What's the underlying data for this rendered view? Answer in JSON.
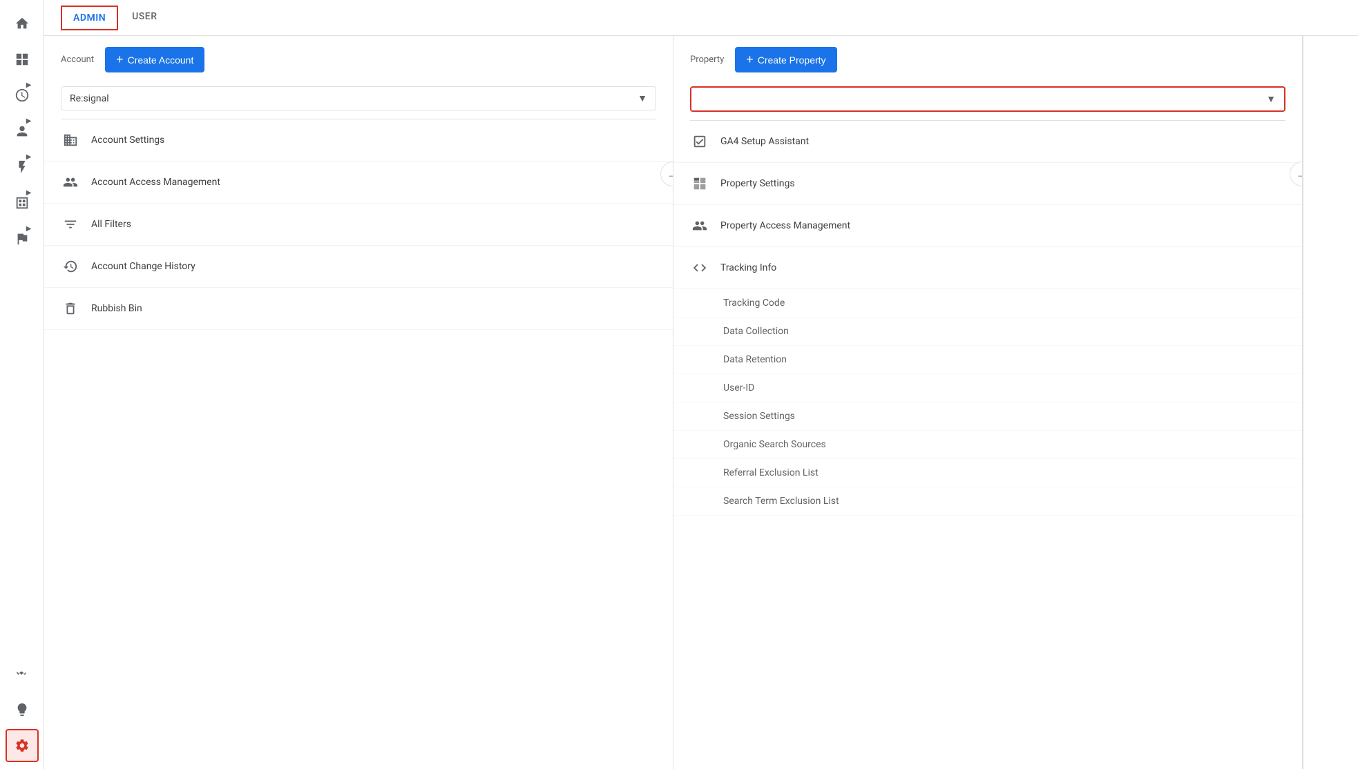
{
  "sidebar": {
    "icons": [
      {
        "name": "home-icon",
        "symbol": "⌂",
        "interactable": true
      },
      {
        "name": "dashboard-icon",
        "symbol": "⊞",
        "interactable": true
      },
      {
        "name": "clock-icon",
        "symbol": "◷",
        "interactable": true
      },
      {
        "name": "person-icon",
        "symbol": "👤",
        "interactable": true
      },
      {
        "name": "lightning-icon",
        "symbol": "⚡",
        "interactable": true
      },
      {
        "name": "table-icon",
        "symbol": "▤",
        "interactable": true
      },
      {
        "name": "flag-icon",
        "symbol": "⚑",
        "interactable": true
      }
    ],
    "bottom_icons": [
      {
        "name": "squiggle-icon",
        "symbol": "∿",
        "interactable": true
      },
      {
        "name": "lightbulb-icon",
        "symbol": "💡",
        "interactable": true
      },
      {
        "name": "gear-icon",
        "symbol": "⚙",
        "interactable": true,
        "active": true
      }
    ]
  },
  "top_nav": {
    "admin_tab": "ADMIN",
    "user_tab": "USER"
  },
  "account_column": {
    "label": "Account",
    "create_button": "Create Account",
    "dropdown_value": "Re:signal",
    "menu_items": [
      {
        "id": "account-settings",
        "icon": "building-icon",
        "label": "Account Settings"
      },
      {
        "id": "account-access",
        "icon": "people-icon",
        "label": "Account Access Management"
      },
      {
        "id": "all-filters",
        "icon": "filter-icon",
        "label": "All Filters"
      },
      {
        "id": "account-history",
        "icon": "history-icon",
        "label": "Account Change History"
      },
      {
        "id": "rubbish-bin",
        "icon": "trash-icon",
        "label": "Rubbish Bin"
      }
    ]
  },
  "property_column": {
    "label": "Property",
    "create_button": "Create Property",
    "dropdown_value": "",
    "dropdown_placeholder": "",
    "menu_items": [
      {
        "id": "ga4-setup",
        "icon": "checkbox-icon",
        "label": "GA4 Setup Assistant"
      },
      {
        "id": "property-settings",
        "icon": "layout-icon",
        "label": "Property Settings"
      },
      {
        "id": "property-access",
        "icon": "people-icon",
        "label": "Property Access Management"
      },
      {
        "id": "tracking-info",
        "icon": "code-icon",
        "label": "Tracking Info",
        "type": "group"
      }
    ],
    "sub_items": [
      {
        "id": "tracking-code",
        "label": "Tracking Code"
      },
      {
        "id": "data-collection",
        "label": "Data Collection"
      },
      {
        "id": "data-retention",
        "label": "Data Retention"
      },
      {
        "id": "user-id",
        "label": "User-ID"
      },
      {
        "id": "session-settings",
        "label": "Session Settings"
      },
      {
        "id": "organic-search",
        "label": "Organic Search Sources"
      },
      {
        "id": "referral-exclusion",
        "label": "Referral Exclusion List"
      },
      {
        "id": "search-term-exclusion",
        "label": "Search Term Exclusion List"
      }
    ]
  },
  "colors": {
    "blue": "#1a73e8",
    "red_border": "#d93025",
    "text_primary": "#3c4043",
    "text_secondary": "#5f6368",
    "divider": "#e0e0e0"
  }
}
